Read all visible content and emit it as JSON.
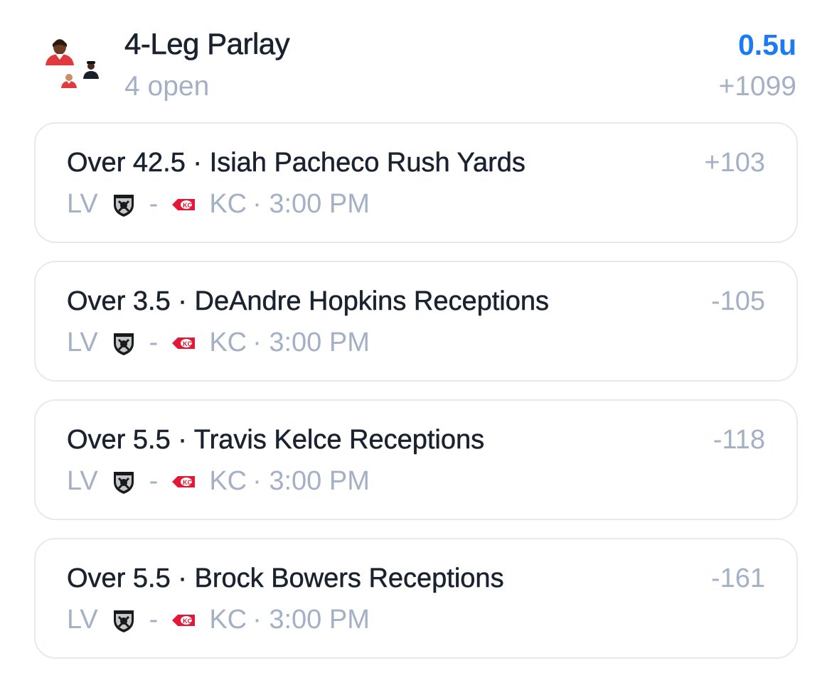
{
  "parlay": {
    "title": "4-Leg Parlay",
    "status": "4 open",
    "stake": "0.5u",
    "odds": "+1099",
    "accent_color": "#1d7af5",
    "muted_color": "#a3b0c6"
  },
  "legs": [
    {
      "title": "Over 42.5 · Isiah Pacheco Rush Yards",
      "odds": "+103",
      "away_team": "LV",
      "away_logo": "raiders-logo-icon",
      "separator": "-",
      "home_team": "KC",
      "home_logo": "chiefs-logo-icon",
      "time": "· 3:00 PM"
    },
    {
      "title": "Over 3.5 · DeAndre Hopkins Receptions",
      "odds": "-105",
      "away_team": "LV",
      "away_logo": "raiders-logo-icon",
      "separator": "-",
      "home_team": "KC",
      "home_logo": "chiefs-logo-icon",
      "time": "· 3:00 PM"
    },
    {
      "title": "Over 5.5 · Travis Kelce Receptions",
      "odds": "-118",
      "away_team": "LV",
      "away_logo": "raiders-logo-icon",
      "separator": "-",
      "home_team": "KC",
      "home_logo": "chiefs-logo-icon",
      "time": "· 3:00 PM"
    },
    {
      "title": "Over 5.5 · Brock Bowers Receptions",
      "odds": "-161",
      "away_team": "LV",
      "away_logo": "raiders-logo-icon",
      "separator": "-",
      "home_team": "KC",
      "home_logo": "chiefs-logo-icon",
      "time": "· 3:00 PM"
    }
  ]
}
